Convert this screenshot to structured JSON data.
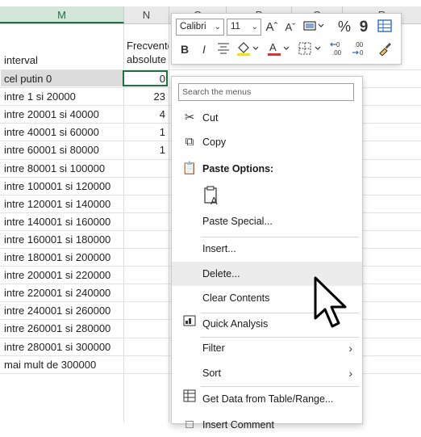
{
  "columns": [
    "M",
    "N",
    "O",
    "P",
    "Q",
    "R"
  ],
  "table": {
    "header_interval": "interval",
    "header_freq": "Frecvente absolute",
    "rows": [
      {
        "label": "cel putin 0",
        "value": "0"
      },
      {
        "label": "intre 1 si 20000",
        "value": "23"
      },
      {
        "label": "intre 20001 si 40000",
        "value": "4"
      },
      {
        "label": "intre 40001 si 60000",
        "value": "1"
      },
      {
        "label": "intre 60001 si 80000",
        "value": "1"
      },
      {
        "label": "intre 80001 si 100000",
        "value": ""
      },
      {
        "label": "intre 100001 si 120000",
        "value": ""
      },
      {
        "label": "intre 120001 si 140000",
        "value": ""
      },
      {
        "label": "intre 140001 si 160000",
        "value": ""
      },
      {
        "label": "intre 160001 si 180000",
        "value": ""
      },
      {
        "label": "intre 180001 si 200000",
        "value": ""
      },
      {
        "label": "intre 200001 si 220000",
        "value": ""
      },
      {
        "label": "intre 220001 si 240000",
        "value": ""
      },
      {
        "label": "intre 240001 si 260000",
        "value": ""
      },
      {
        "label": "intre 260001 si 280000",
        "value": ""
      },
      {
        "label": "intre 280001 si 300000",
        "value": ""
      },
      {
        "label": "mai mult de 300000",
        "value": ""
      }
    ]
  },
  "mini_toolbar": {
    "font_name": "Calibri",
    "font_size": "11",
    "increase_font": "Aˆ",
    "decrease_font": "Aˇ",
    "percent": "%",
    "comma": "9",
    "bold": "B",
    "italic": "I",
    "dec_increase": ".00",
    "dec_decrease": ".00"
  },
  "context_menu": {
    "search_placeholder": "Search the menus",
    "items": [
      {
        "label": "Cut",
        "icon": "scissors-icon"
      },
      {
        "label": "Copy",
        "icon": "copy-icon"
      },
      {
        "label": "Paste Options:",
        "icon": "clipboard-icon"
      },
      {
        "label": "Paste Special...",
        "icon": ""
      },
      {
        "label": "Insert...",
        "icon": ""
      },
      {
        "label": "Delete...",
        "icon": ""
      },
      {
        "label": "Clear Contents",
        "icon": ""
      },
      {
        "label": "Quick Analysis",
        "icon": "quick-analysis-icon"
      },
      {
        "label": "Filter",
        "icon": ""
      },
      {
        "label": "Sort",
        "icon": ""
      },
      {
        "label": "Get Data from Table/Range...",
        "icon": "table-icon"
      },
      {
        "label": "Insert Comment",
        "icon": "comment-icon"
      }
    ]
  },
  "colors": {
    "accent": "#1e7145",
    "font_color_bar": "#e03131",
    "highlight_bar": "#f5e400"
  }
}
